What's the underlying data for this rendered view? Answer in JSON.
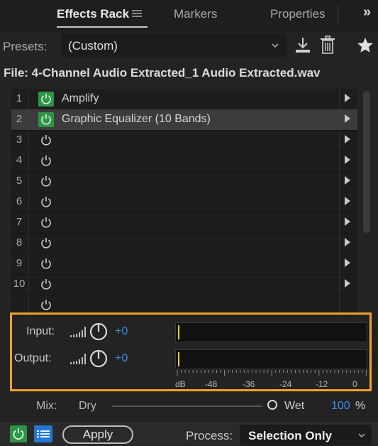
{
  "tabs": [
    {
      "label": "Effects Rack",
      "active": true
    },
    {
      "label": "Markers",
      "active": false
    },
    {
      "label": "Properties",
      "active": false
    }
  ],
  "tab_overflow": "»",
  "presets": {
    "label": "Presets:",
    "value": "(Custom)"
  },
  "file_line": "File: 4-Channel Audio Extracted_1 Audio Extracted.wav",
  "rack": {
    "rows": [
      {
        "num": "1",
        "name": "Amplify",
        "on": true,
        "selected": false
      },
      {
        "num": "2",
        "name": "Graphic Equalizer (10 Bands)",
        "on": true,
        "selected": true
      },
      {
        "num": "3",
        "name": "",
        "on": false,
        "selected": false
      },
      {
        "num": "4",
        "name": "",
        "on": false,
        "selected": false
      },
      {
        "num": "5",
        "name": "",
        "on": false,
        "selected": false
      },
      {
        "num": "6",
        "name": "",
        "on": false,
        "selected": false
      },
      {
        "num": "7",
        "name": "",
        "on": false,
        "selected": false
      },
      {
        "num": "8",
        "name": "",
        "on": false,
        "selected": false
      },
      {
        "num": "9",
        "name": "",
        "on": false,
        "selected": false
      },
      {
        "num": "10",
        "name": "",
        "on": false,
        "selected": false
      }
    ]
  },
  "io": {
    "input": {
      "label": "Input:",
      "value": "+0"
    },
    "output": {
      "label": "Output:",
      "value": "+0"
    },
    "scale": [
      "dB",
      "-48",
      "-36",
      "-24",
      "-12",
      "0"
    ]
  },
  "mix": {
    "label": "Mix:",
    "dry": "Dry",
    "wet": "Wet",
    "value": "100",
    "unit": "%"
  },
  "bottom": {
    "apply": "Apply",
    "process_label": "Process:",
    "process_value": "Selection Only"
  },
  "colors": {
    "accent_green": "#2e9446",
    "accent_blue": "#3d8ee8",
    "highlight_orange": "#f2a12a"
  },
  "icons": [
    "hamburger-menu-icon",
    "overflow-chevron-icon",
    "dropdown-chevron-icon",
    "download-preset-icon",
    "trash-icon",
    "star-icon",
    "power-icon",
    "play-arrow-icon",
    "signal-bars-icon",
    "knob-icon",
    "list-icon"
  ]
}
